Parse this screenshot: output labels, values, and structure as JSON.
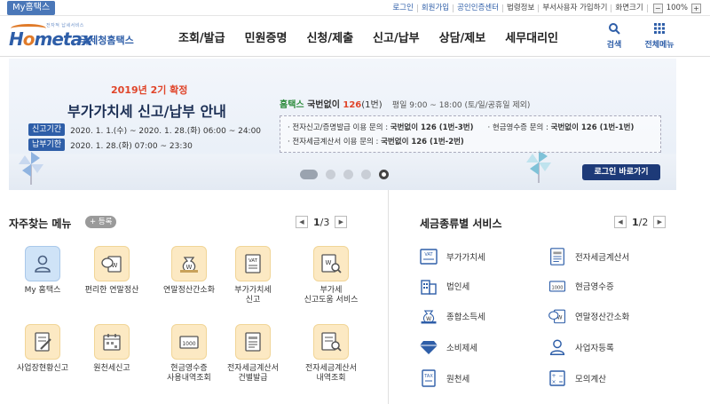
{
  "topbar": {
    "my_hometax": "My홈택스",
    "links": [
      "로그인",
      "회원가입",
      "공인인증센터",
      "법령정보",
      "부서사용자 가입하기",
      "화면크기"
    ],
    "zoom_minus": "−",
    "zoom_value": "100%",
    "zoom_plus": "+"
  },
  "header": {
    "logo_tagline": "전자적 납세서비스",
    "logo_word_a": "H",
    "logo_word_o": "o",
    "logo_word_b": "metax",
    "logo_kr": "국세청홈택스",
    "menu": [
      "조회/발급",
      "민원증명",
      "신청/제출",
      "신고/납부",
      "상담/제보",
      "세무대리인"
    ],
    "search_label": "검색",
    "allmenu_label": "전체메뉴"
  },
  "banner": {
    "subtitle": "2019년 2기 확정",
    "title": "부가가치세 신고/납부 안내",
    "period_tag": "신고기간",
    "period_text": "2020. 1. 1.(수) ~ 2020. 1. 28.(화) 06:00 ~ 24:00",
    "deadline_tag": "납부기한",
    "deadline_text": "2020. 1. 28.(화) 07:00 ~ 23:30",
    "hometax_label": "홈택스",
    "national_label": " 국번없이 ",
    "national_num": "126",
    "national_ext": "(1번)",
    "hours": "평일 9:00 ~ 18:00 (토/일/공휴일 제외)",
    "info_line1_a": "· 전자신고/증명발급 이용 문의 : ",
    "info_line1_b": "국번없이 126 (1번-3번)",
    "info_line1_c": "· 현금영수증 문의 : ",
    "info_line1_d": "국번없이 126 (1번-1번)",
    "info_line2_a": "· 전자세금계산서 이용 문의 : ",
    "info_line2_b": "국번없이 126 (1번-2번)",
    "login_button": "로그인 바로가기"
  },
  "favorites": {
    "title": "자주찾는 메뉴",
    "add_label": "+ 등록",
    "page_current": "1",
    "page_total": "/3",
    "items": [
      {
        "label": "My 홈택스",
        "icon": "person-icon"
      },
      {
        "label": "편리한 연말정산",
        "icon": "coin-doc-icon"
      },
      {
        "label": "연말정산간소화",
        "icon": "money-bag-icon"
      },
      {
        "label": "부가가치세\n신고",
        "icon": "vat-doc-icon"
      },
      {
        "label": "부가세\n신고도움 서비스",
        "icon": "search-doc-icon"
      },
      {
        "label": "사업장현황신고",
        "icon": "edit-doc-icon"
      },
      {
        "label": "원천세신고",
        "icon": "calendar-icon"
      },
      {
        "label": "현금영수증\n사용내역조회",
        "icon": "receipt-icon"
      },
      {
        "label": "전자세금계산서\n건별발급",
        "icon": "invoice-icon"
      },
      {
        "label": "전자세금계산서\n내역조회",
        "icon": "invoice-search-icon"
      }
    ]
  },
  "tax_services": {
    "title": "세금종류별 서비스",
    "page_current": "1",
    "page_total": "/2",
    "items": [
      {
        "label": "부가가치세",
        "icon": "vat-icon"
      },
      {
        "label": "전자세금계산서",
        "icon": "invoice-icon"
      },
      {
        "label": "법인세",
        "icon": "building-icon"
      },
      {
        "label": "현금영수증",
        "icon": "receipt-icon"
      },
      {
        "label": "종합소득세",
        "icon": "money-bag-icon"
      },
      {
        "label": "연말정산간소화",
        "icon": "coin-doc-icon"
      },
      {
        "label": "소비제세",
        "icon": "diamond-icon"
      },
      {
        "label": "사업자등록",
        "icon": "person-icon"
      },
      {
        "label": "원천세",
        "icon": "doc-icon"
      },
      {
        "label": "모의계산",
        "icon": "calculator-icon"
      }
    ]
  },
  "colors": {
    "brand_blue": "#2e5ea8",
    "accent_red": "#e0452a",
    "fav_bg": "#fce9c3"
  }
}
